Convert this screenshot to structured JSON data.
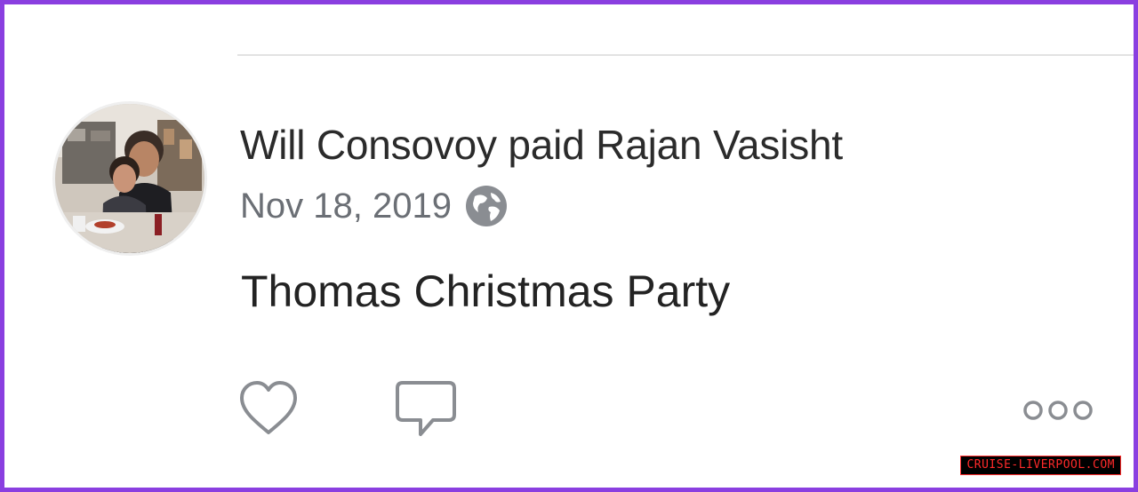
{
  "post": {
    "payer": "Will Consovoy",
    "verb": "paid",
    "payee": "Rajan Vasisht",
    "date": "Nov 18, 2019",
    "privacy_icon": "globe-icon",
    "message": "Thomas Christmas Party"
  },
  "actions": {
    "like_icon": "heart-icon",
    "comment_icon": "comment-bubble-icon",
    "more_icon": "more-dots-icon"
  },
  "watermark": {
    "text": "CRUISE-LIVERPOOL.COM"
  },
  "colors": {
    "frame": "#8a3fe0",
    "text_primary": "#2b2b2b",
    "text_secondary": "#6b6f75",
    "icon": "#8a8d92",
    "watermark_bg": "#000000",
    "watermark_text": "#ff2a2a"
  }
}
